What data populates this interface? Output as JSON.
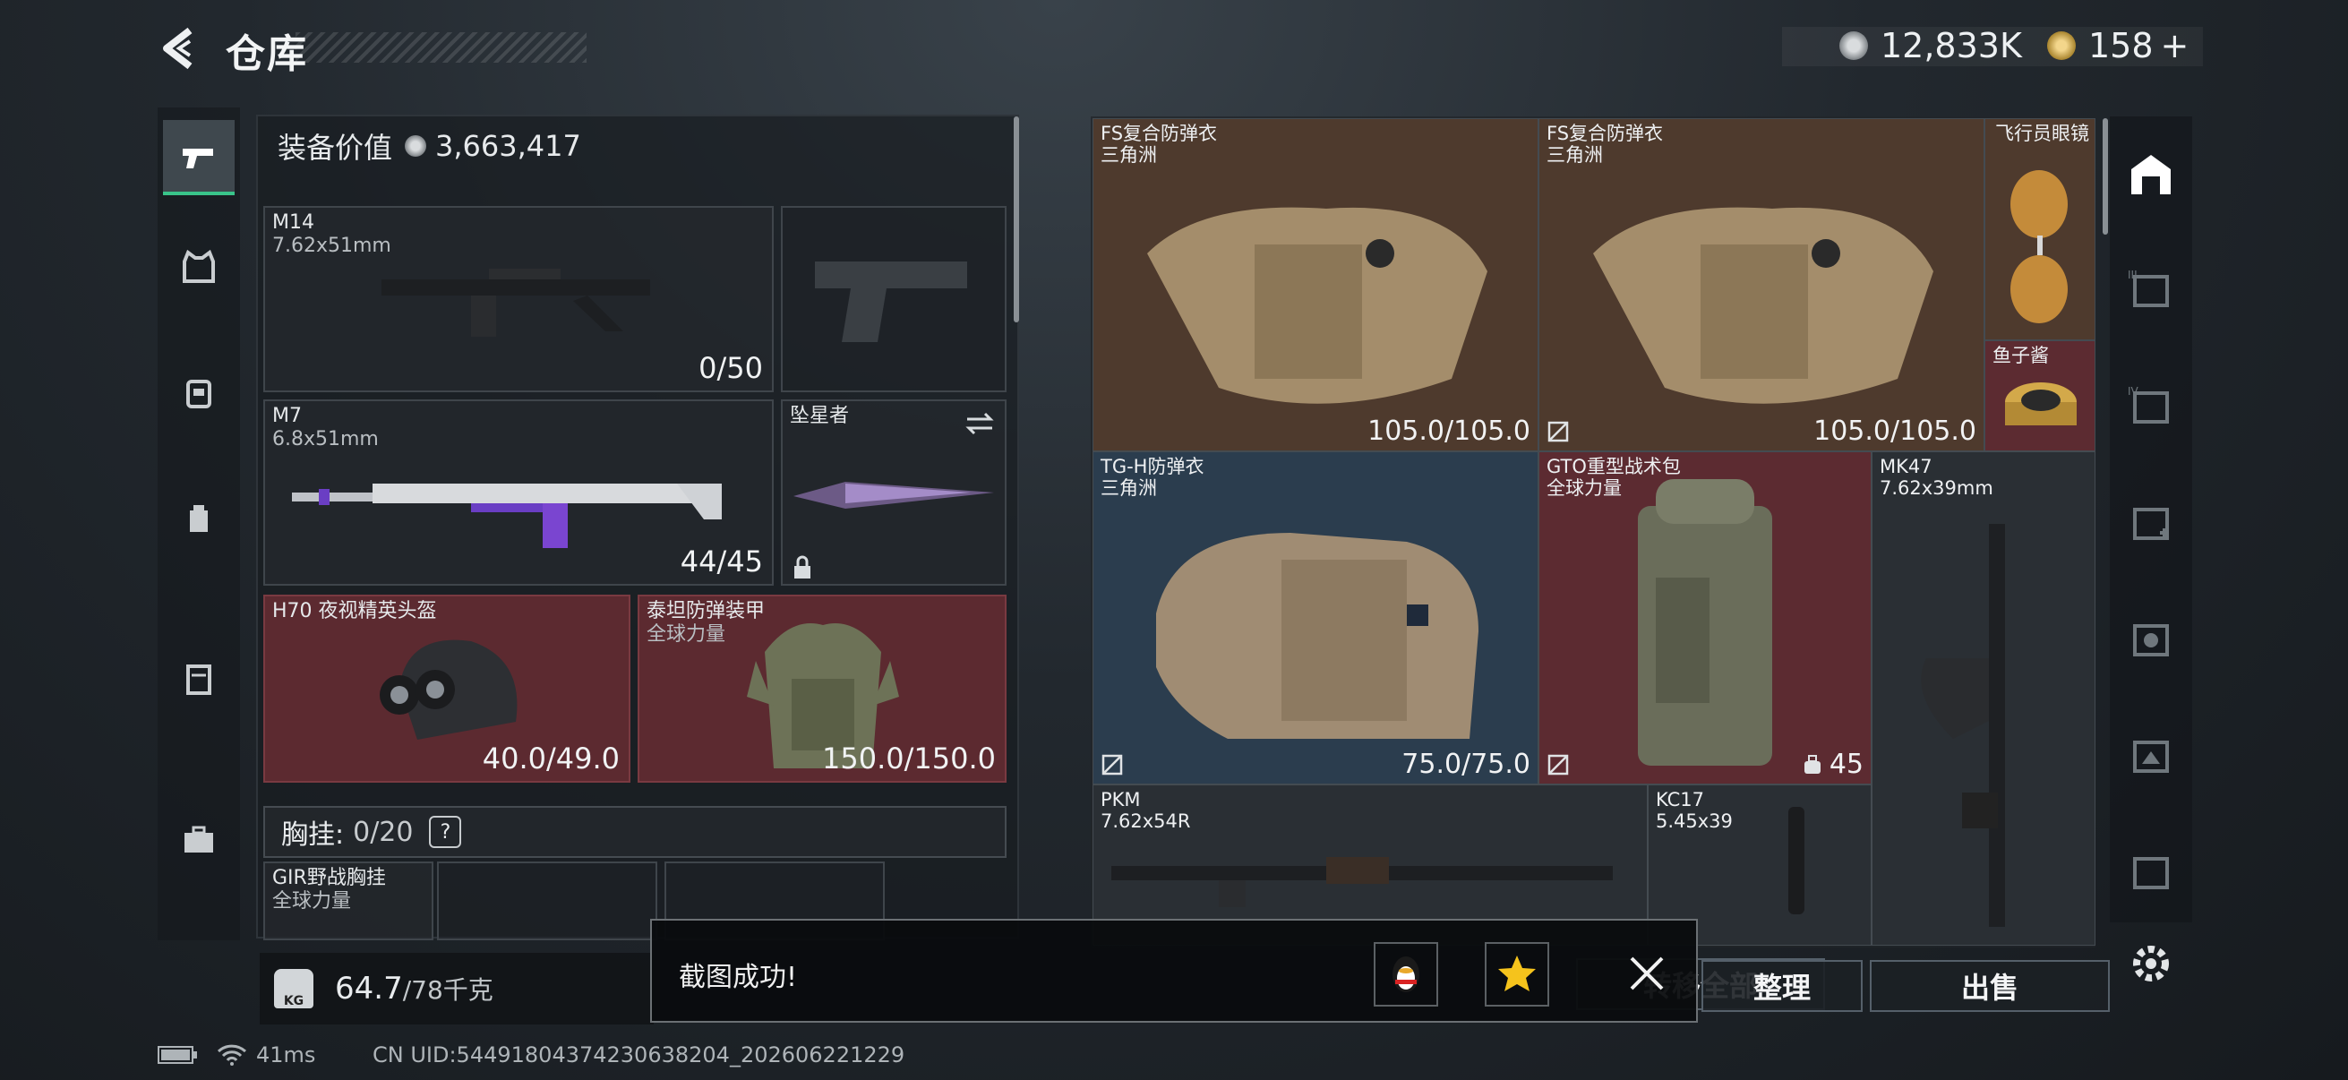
{
  "header": {
    "title": "仓库"
  },
  "currency": {
    "silver": "12,833K",
    "gold": "158",
    "gold_plus": "+"
  },
  "loadout": {
    "value_label": "装备价值",
    "value": "3,663,417",
    "slots": [
      {
        "name": "M14",
        "sub": "7.62x51mm",
        "count": "0/50"
      },
      {
        "name": "M7",
        "sub": "6.8x51mm",
        "count": "44/45"
      },
      {
        "name": "坠星者",
        "sub": "",
        "count": ""
      },
      {
        "name": "H70 夜视精英头盔",
        "sub": "",
        "count": "40.0/49.0"
      },
      {
        "name": "泰坦防弹装甲",
        "sub": "全球力量",
        "count": "150.0/150.0"
      }
    ],
    "rig_label": "胸挂:",
    "rig_count": "0/20",
    "rig_help": "?",
    "rig_item": {
      "name": "GIR野战胸挂",
      "sub": "全球力量"
    },
    "weight": "64.7",
    "weight_max": "/78千克"
  },
  "storage": [
    {
      "name": "FS复合防弹衣",
      "sub": "三角洲",
      "count": "105.0/105.0"
    },
    {
      "name": "FS复合防弹衣",
      "sub": "三角洲",
      "count": "105.0/105.0"
    },
    {
      "name": "飞行员眼镜",
      "sub": "",
      "count": ""
    },
    {
      "name": "鱼子酱",
      "sub": "",
      "count": ""
    },
    {
      "name": "TG-H防弹衣",
      "sub": "三角洲",
      "count": "75.0/75.0"
    },
    {
      "name": "GTO重型战术包",
      "sub": "全球力量",
      "count": "45"
    },
    {
      "name": "MK47",
      "sub": "7.62x39mm",
      "count": ""
    },
    {
      "name": "PKM",
      "sub": "7.62x54R",
      "count": ""
    },
    {
      "name": "KC17",
      "sub": "5.45x39",
      "count": ""
    }
  ],
  "actions": {
    "sort": "整理",
    "sell": "出售",
    "transfer_all": "转移全部"
  },
  "toast": {
    "message": "截图成功!"
  },
  "status": {
    "ping": "41ms",
    "uid": "CN UID:54491804374230638204_202606221229"
  },
  "colors": {
    "accent": "#39c48a",
    "slot_red": "#5c2a30",
    "armor_brown": "#4e3a2d",
    "armor_blue": "#2b3d4e"
  }
}
